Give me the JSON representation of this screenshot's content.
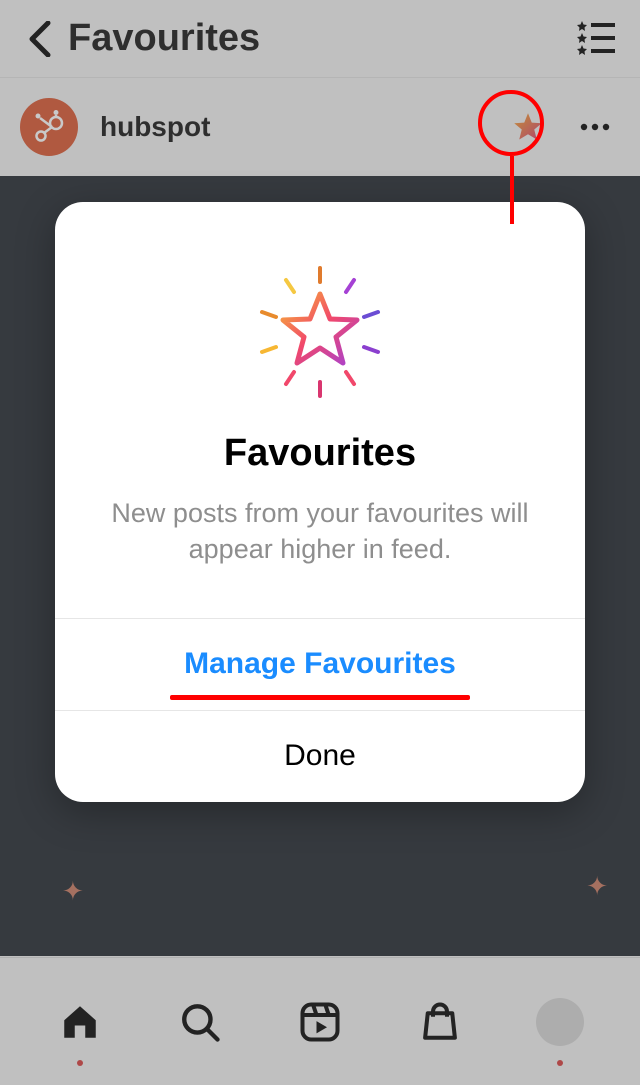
{
  "header": {
    "title": "Favourites"
  },
  "post": {
    "username": "hubspot"
  },
  "modal": {
    "title": "Favourites",
    "description": "New posts from your favourites will appear higher in feed.",
    "manage_label": "Manage Favourites",
    "done_label": "Done"
  }
}
